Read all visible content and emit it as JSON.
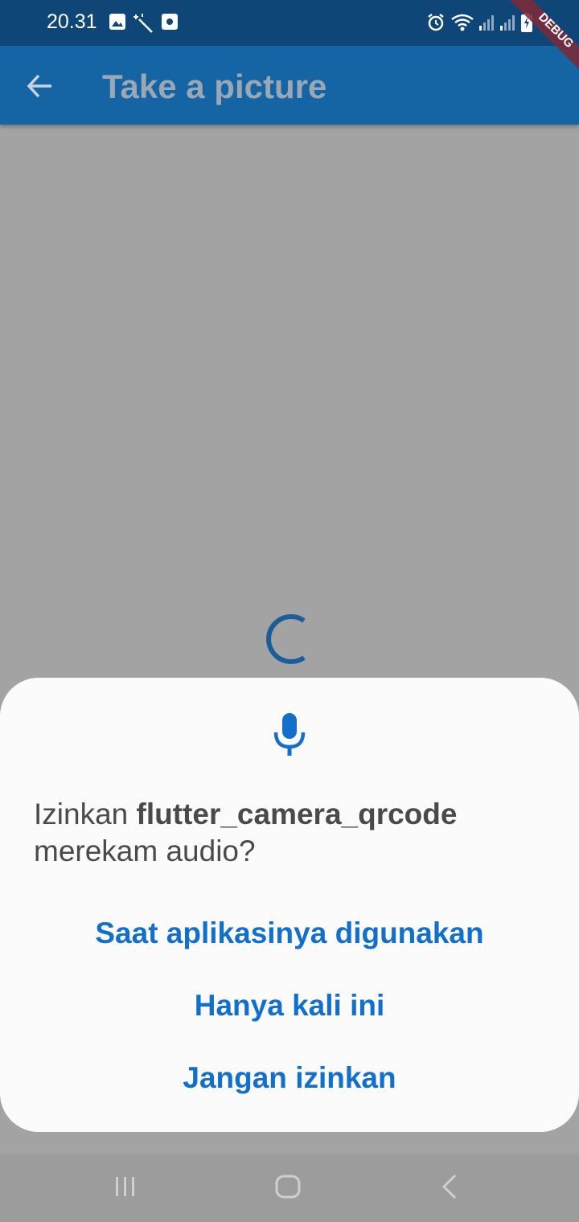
{
  "status_bar": {
    "time": "20.31",
    "left_icons": [
      "image-icon",
      "magic-wand-icon",
      "screen-record-icon"
    ],
    "right_icons": [
      "alarm-icon",
      "wifi-icon",
      "signal-icon",
      "signal-icon",
      "battery-charging-icon"
    ]
  },
  "app_bar": {
    "title": "Take a picture",
    "back_icon": "arrow-back-icon",
    "color": "#1565a5"
  },
  "debug_banner": {
    "label": "DEBUG"
  },
  "permission_dialog": {
    "icon": "microphone-icon",
    "text_prefix": "Izinkan ",
    "app_name": "flutter_camera_qrcode",
    "text_suffix": "merekam audio?",
    "options": [
      "Saat aplikasinya digunakan",
      "Hanya kali ini",
      "Jangan izinkan"
    ],
    "accent_color": "#1270cc"
  },
  "nav_bar": {
    "buttons": [
      "recent-apps-icon",
      "home-icon",
      "back-icon"
    ]
  }
}
